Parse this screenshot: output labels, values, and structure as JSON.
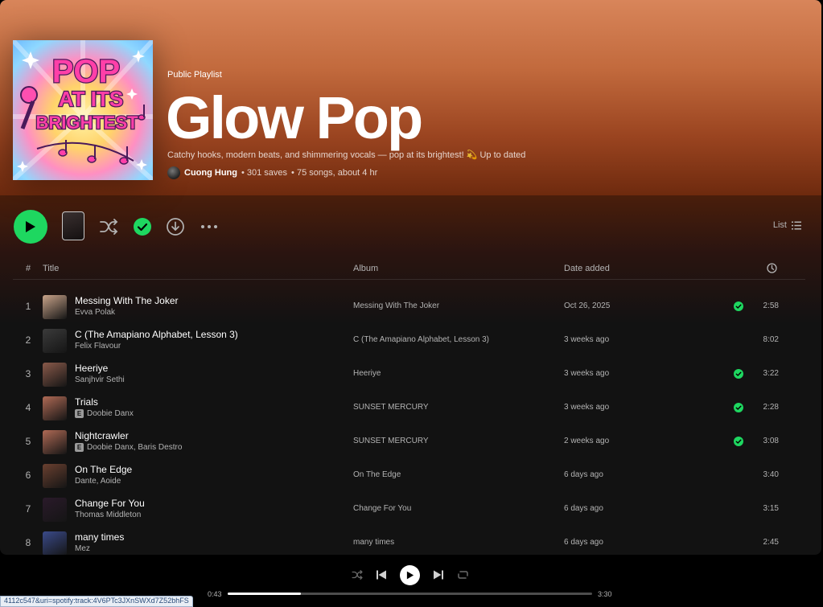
{
  "playlist": {
    "type_label": "Public Playlist",
    "title": "Glow Pop",
    "description": "Catchy hooks, modern beats, and shimmering vocals — pop at its brightest! 💫 Up to dated",
    "owner": "Cuong Hung",
    "saves": "• 301 saves",
    "summary": "• 75 songs, about 4 hr",
    "cover_text": [
      "POP",
      "AT ITS",
      "BRIGHTEST"
    ]
  },
  "actions": {
    "list_label": "List"
  },
  "table": {
    "headers": {
      "num": "#",
      "title": "Title",
      "album": "Album",
      "date": "Date added"
    },
    "rows": [
      {
        "num": "1",
        "title": "Messing With The Joker",
        "artist": "Evva Polak",
        "explicit": false,
        "album": "Messing With The Joker",
        "date": "Oct 26, 2025",
        "saved": true,
        "duration": "2:58",
        "art_color": "#c9a48a"
      },
      {
        "num": "2",
        "title": "C (The Amapiano Alphabet, Lesson 3)",
        "artist": "Felix Flavour",
        "explicit": false,
        "album": "C (The Amapiano Alphabet, Lesson 3)",
        "date": "3 weeks ago",
        "saved": false,
        "duration": "8:02",
        "art_color": "#3b3b3b"
      },
      {
        "num": "3",
        "title": "Heeriye",
        "artist": "Sanjhvir Sethi",
        "explicit": false,
        "album": "Heeriye",
        "date": "3 weeks ago",
        "saved": true,
        "duration": "3:22",
        "art_color": "#8a5a4a"
      },
      {
        "num": "4",
        "title": "Trials",
        "artist": "Doobie Danx",
        "explicit": true,
        "album": "SUNSET MERCURY",
        "date": "3 weeks ago",
        "saved": true,
        "duration": "2:28",
        "art_color": "#b06a55"
      },
      {
        "num": "5",
        "title": "Nightcrawler",
        "artist": "Doobie Danx, Baris Destro",
        "explicit": true,
        "album": "SUNSET MERCURY",
        "date": "2 weeks ago",
        "saved": true,
        "duration": "3:08",
        "art_color": "#b06a55"
      },
      {
        "num": "6",
        "title": "On The Edge",
        "artist": "Dante, Aoide",
        "explicit": false,
        "album": "On The Edge",
        "date": "6 days ago",
        "saved": false,
        "duration": "3:40",
        "art_color": "#6a4030"
      },
      {
        "num": "7",
        "title": "Change For You",
        "artist": "Thomas Middleton",
        "explicit": false,
        "album": "Change For You",
        "date": "6 days ago",
        "saved": false,
        "duration": "3:15",
        "art_color": "#2a1a2a"
      },
      {
        "num": "8",
        "title": "many times",
        "artist": "Mez",
        "explicit": false,
        "album": "many times",
        "date": "6 days ago",
        "saved": false,
        "duration": "2:45",
        "art_color": "#3a4a8a"
      }
    ]
  },
  "player": {
    "elapsed": "0:43",
    "total": "3:30",
    "progress": 0.2
  },
  "status_url": "4112c547&uri=spotify:track:4V6PTc3JXnSWXd7Z52bhFS",
  "explicit_label": "E",
  "colors": {
    "accent": "#1ed760"
  }
}
